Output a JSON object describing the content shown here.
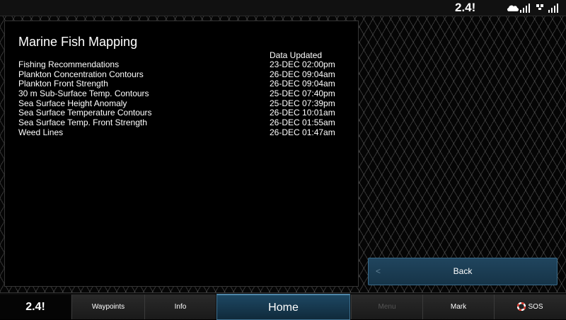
{
  "status_bar": {
    "time": "2.4!",
    "icons": [
      "weather-signal-icon",
      "satellite-signal-icon"
    ]
  },
  "panel": {
    "title": "Marine Fish Mapping",
    "column_header": "Data Updated",
    "rows": [
      {
        "name": "Fishing Recommendations",
        "updated": "23-DEC 02:00pm"
      },
      {
        "name": "Plankton Concentration Contours",
        "updated": "26-DEC 09:04am"
      },
      {
        "name": "Plankton Front Strength",
        "updated": "26-DEC 09:04am"
      },
      {
        "name": "30 m Sub-Surface Temp. Contours",
        "updated": "25-DEC 07:40pm"
      },
      {
        "name": "Sea Surface Height Anomaly",
        "updated": "25-DEC 07:39pm"
      },
      {
        "name": "Sea Surface Temperature Contours",
        "updated": "26-DEC 10:01am"
      },
      {
        "name": "Sea Surface Temp. Front Strength",
        "updated": "26-DEC 01:55am"
      },
      {
        "name": "Weed Lines",
        "updated": "26-DEC 01:47am"
      }
    ]
  },
  "back_button": {
    "label": "Back"
  },
  "nav": {
    "time": "2.4!",
    "waypoints": "Waypoints",
    "info": "Info",
    "home": "Home",
    "menu": "Menu",
    "mark": "Mark",
    "sos": "SOS"
  },
  "colors": {
    "accent": "#1d4762",
    "accent_border": "#3f7190",
    "sos": "#e03a2e"
  }
}
